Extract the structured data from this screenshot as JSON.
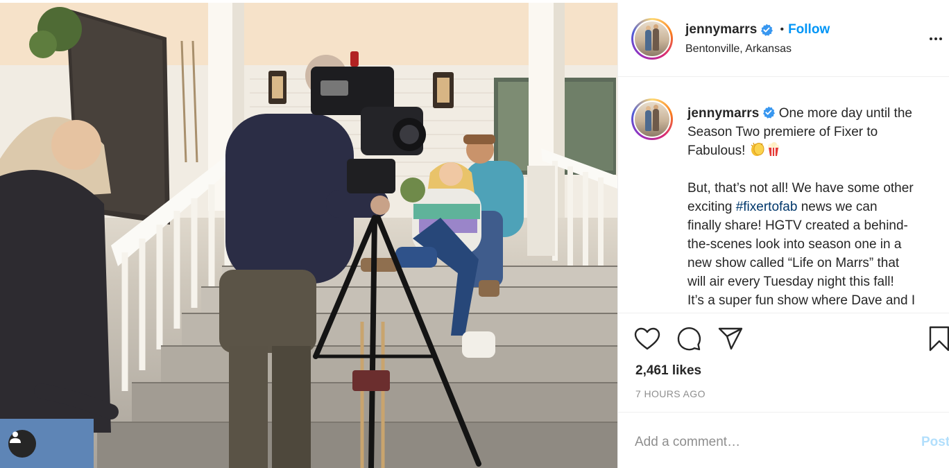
{
  "post": {
    "username": "jennymarrs",
    "follow_label": "Follow",
    "separator": "•",
    "location": "Bentonville, Arkansas",
    "caption_lines": [
      " One more day until the",
      "Season Two premiere of Fixer to",
      "Fabulous! ",
      "",
      "But, that’s not all! We have some other",
      "exciting ",
      "finally share! HGTV created a behind-",
      "the-scenes look into season one in a",
      "new show called “Life on Marrs” that",
      "will air every Tuesday night this fall!",
      "It’s a super fun show where Dave and I"
    ],
    "hashtag": "#fixertofab",
    "hashtag_suffix": " news we can",
    "likes": "2,461 likes",
    "timestamp": "7 HOURS AGO",
    "comment_placeholder": "Add a comment…",
    "post_label": "Post"
  },
  "icons": {
    "verified": "verified-badge-icon",
    "more": "more-options-icon",
    "like": "heart-icon",
    "comment": "comment-bubble-icon",
    "share": "paper-plane-icon",
    "save": "bookmark-icon",
    "user_tag": "user-silhouette-icon",
    "caption_emojis": [
      "clapping-hands-icon",
      "popcorn-icon"
    ]
  },
  "colors": {
    "follow_link": "#0095f6",
    "hashtag_link": "#00376b",
    "verified_badge": "#3897f0",
    "post_disabled": "#b2dffc",
    "muted_text": "#8e8e8e",
    "divider": "#efefef"
  }
}
